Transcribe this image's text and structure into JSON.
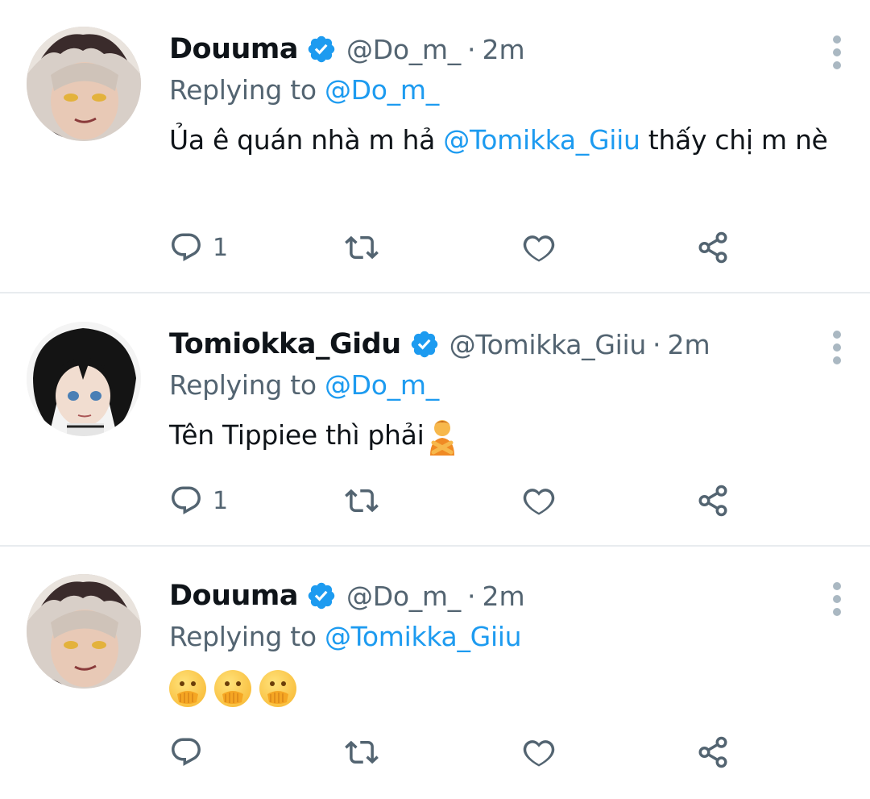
{
  "tweets": [
    {
      "name": "Douuma",
      "handle": "@Do_m_",
      "dot": "·",
      "time": "2m",
      "replying_prefix": "Replying to",
      "replying_to": "@Do_m_",
      "text_parts": [
        "Ủa ê quán nhà m hả ",
        "@Tomikka_Giiu",
        " thấy chị m nè"
      ],
      "reply_count": "1",
      "avatar": "douuma-avatar"
    },
    {
      "name": "Tomiokka_Gidu",
      "handle": "@Tomikka_Giiu",
      "dot": "·",
      "time": "2m",
      "replying_prefix": "Replying to",
      "replying_to": "@Do_m_",
      "text": "Tên Tippiee thì phải",
      "text_emoji": "person-gesturing-no-emoji",
      "reply_count": "1",
      "avatar": "tomiokka-avatar"
    },
    {
      "name": "Douuma",
      "handle": "@Do_m_",
      "dot": "·",
      "time": "2m",
      "replying_prefix": "Replying to",
      "replying_to": "@Tomikka_Giiu",
      "text_emojis": [
        "hand-over-mouth-emoji",
        "hand-over-mouth-emoji",
        "hand-over-mouth-emoji"
      ],
      "reply_count": "",
      "avatar": "douuma-avatar"
    }
  ],
  "icons": {
    "verified": "verified-badge-icon",
    "more": "more-vertical-icon",
    "reply": "reply-icon",
    "retweet": "retweet-icon",
    "like": "heart-icon",
    "share": "share-icon"
  },
  "colors": {
    "accent": "#1d9bf0",
    "secondary_text": "#536471",
    "divider": "#e8ecef"
  }
}
